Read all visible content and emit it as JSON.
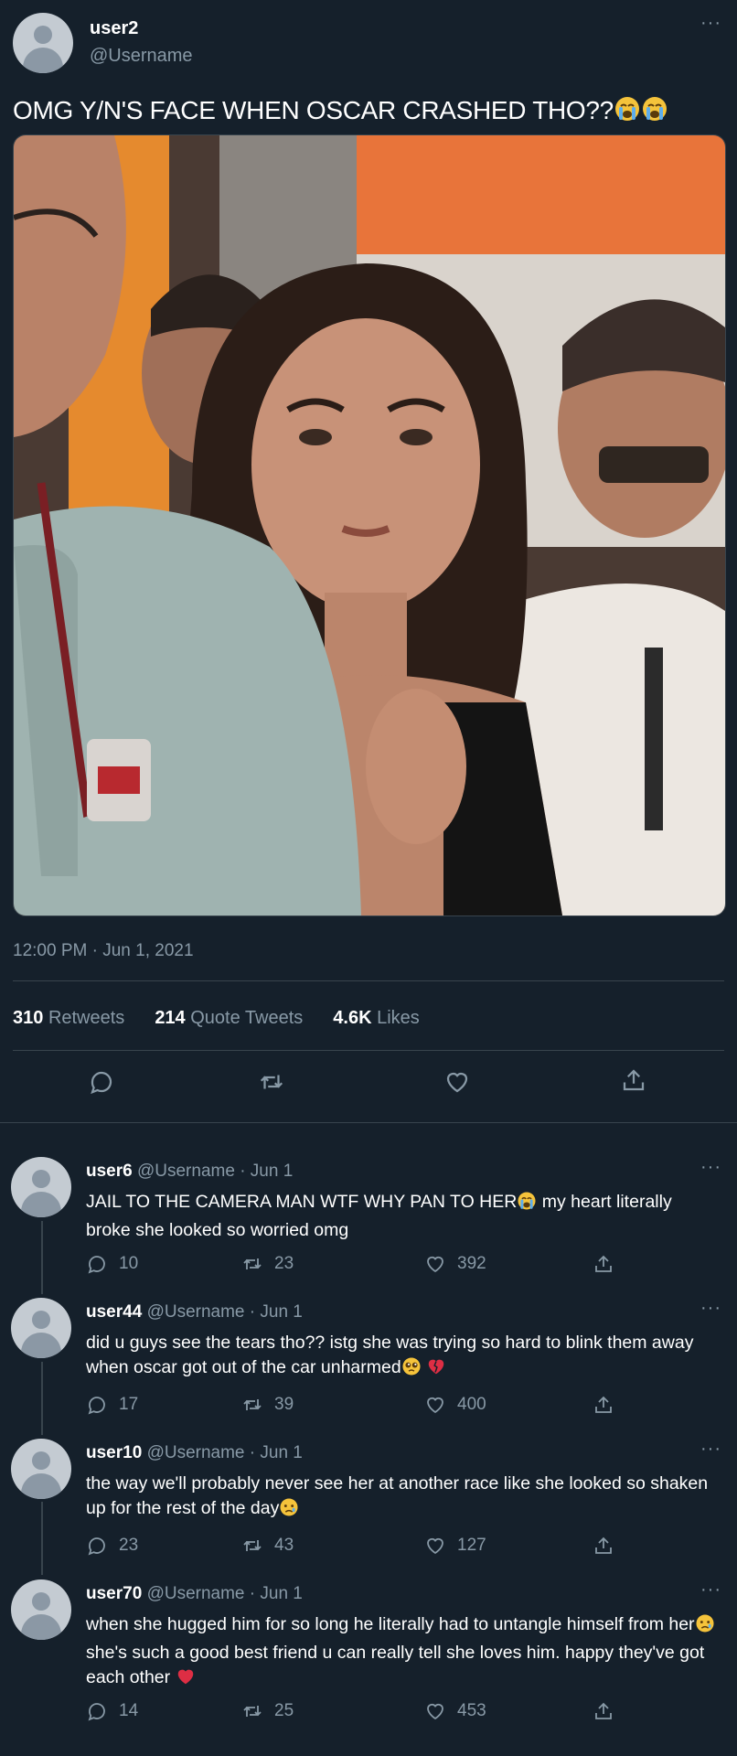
{
  "tweet": {
    "display_name": "user2",
    "handle": "@Username",
    "text": "OMG Y/N'S FACE WHEN OSCAR CRASHED THO??",
    "text_emojis": [
      "loudly-crying-emoji",
      "loudly-crying-emoji"
    ],
    "timestamp": "12:00 PM · Jun 1, 2021",
    "stats": {
      "retweets_count": "310",
      "retweets_label": "Retweets",
      "quotes_count": "214",
      "quotes_label": "Quote Tweets",
      "likes_count": "4.6K",
      "likes_label": "Likes"
    },
    "actions": [
      "reply-icon",
      "retweet-icon",
      "like-icon",
      "share-icon"
    ]
  },
  "replies": [
    {
      "display_name": "user6",
      "meta": "@Username · Jun 1",
      "text_a": "JAIL TO THE CAMERA MAN WTF WHY PAN TO HER",
      "emoji_a": "loudly-crying-emoji",
      "text_b": " my heart literally broke she looked so worried omg",
      "reply_count": "10",
      "retweet_count": "23",
      "like_count": "392"
    },
    {
      "display_name": "user44",
      "meta": "@Username · Jun 1",
      "text_a": "did u guys see the tears tho?? istg she was trying so hard to blink them away when oscar got out of the car unharmed",
      "emoji_a": "pleading-face-emoji",
      "emoji_b": "broken-heart-emoji",
      "reply_count": "17",
      "retweet_count": "39",
      "like_count": "400"
    },
    {
      "display_name": "user10",
      "meta": "@Username · Jun 1",
      "text_a": "the way we'll probably never see her at another race like she looked so shaken up for the rest of the day",
      "emoji_a": "crying-face-emoji",
      "reply_count": "23",
      "retweet_count": "43",
      "like_count": "127"
    },
    {
      "display_name": "user70",
      "meta": "@Username · Jun 1",
      "text_a": "when she hugged him for so long he literally had to untangle himself from her",
      "emoji_a": "crying-face-emoji",
      "text_b": " she's such a good best friend u can really tell she loves him. happy they've got each other",
      "emoji_b": "red-heart-emoji",
      "reply_count": "14",
      "retweet_count": "25",
      "like_count": "453"
    }
  ],
  "colors": {
    "background": "#15202b",
    "divider": "#38444d",
    "muted_text": "#8899a6",
    "text": "#ffffff"
  }
}
